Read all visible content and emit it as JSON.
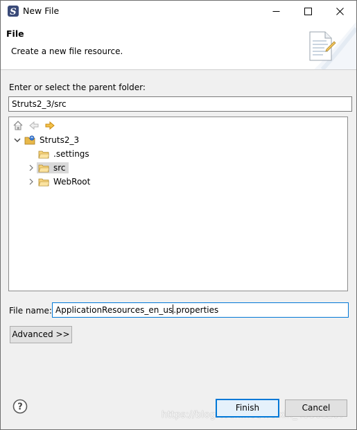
{
  "window": {
    "title": "New File",
    "app_icon": "eclipse-s-icon",
    "controls": [
      "minimize-icon",
      "maximize-icon",
      "close-icon"
    ]
  },
  "header": {
    "title": "File",
    "description": "Create a new file resource.",
    "graphic": "new-file-document-icon"
  },
  "parent_folder": {
    "label": "Enter or select the parent folder:",
    "value": "Struts2_3/src"
  },
  "tree_toolbar": [
    "home-icon",
    "back-arrow-icon",
    "forward-arrow-icon"
  ],
  "tree": [
    {
      "label": "Struts2_3",
      "expanded": true,
      "type": "project"
    },
    {
      "label": ".settings",
      "type": "folder"
    },
    {
      "label": "src",
      "type": "folder",
      "selected": true
    },
    {
      "label": "WebRoot",
      "type": "folder"
    }
  ],
  "file_name": {
    "label": "File name:",
    "value_before_caret": "ApplicationResources_en_us",
    "value_after_caret": ".properties"
  },
  "buttons": {
    "advanced": "Advanced >>",
    "finish": "Finish",
    "cancel": "Cancel"
  },
  "watermark": "https://blog.csdn.net/weixin_43561207",
  "colors": {
    "focus_blue": "#0078d7",
    "folder_yellow": "#e8b84a",
    "forward_arrow": "#e8a020"
  }
}
